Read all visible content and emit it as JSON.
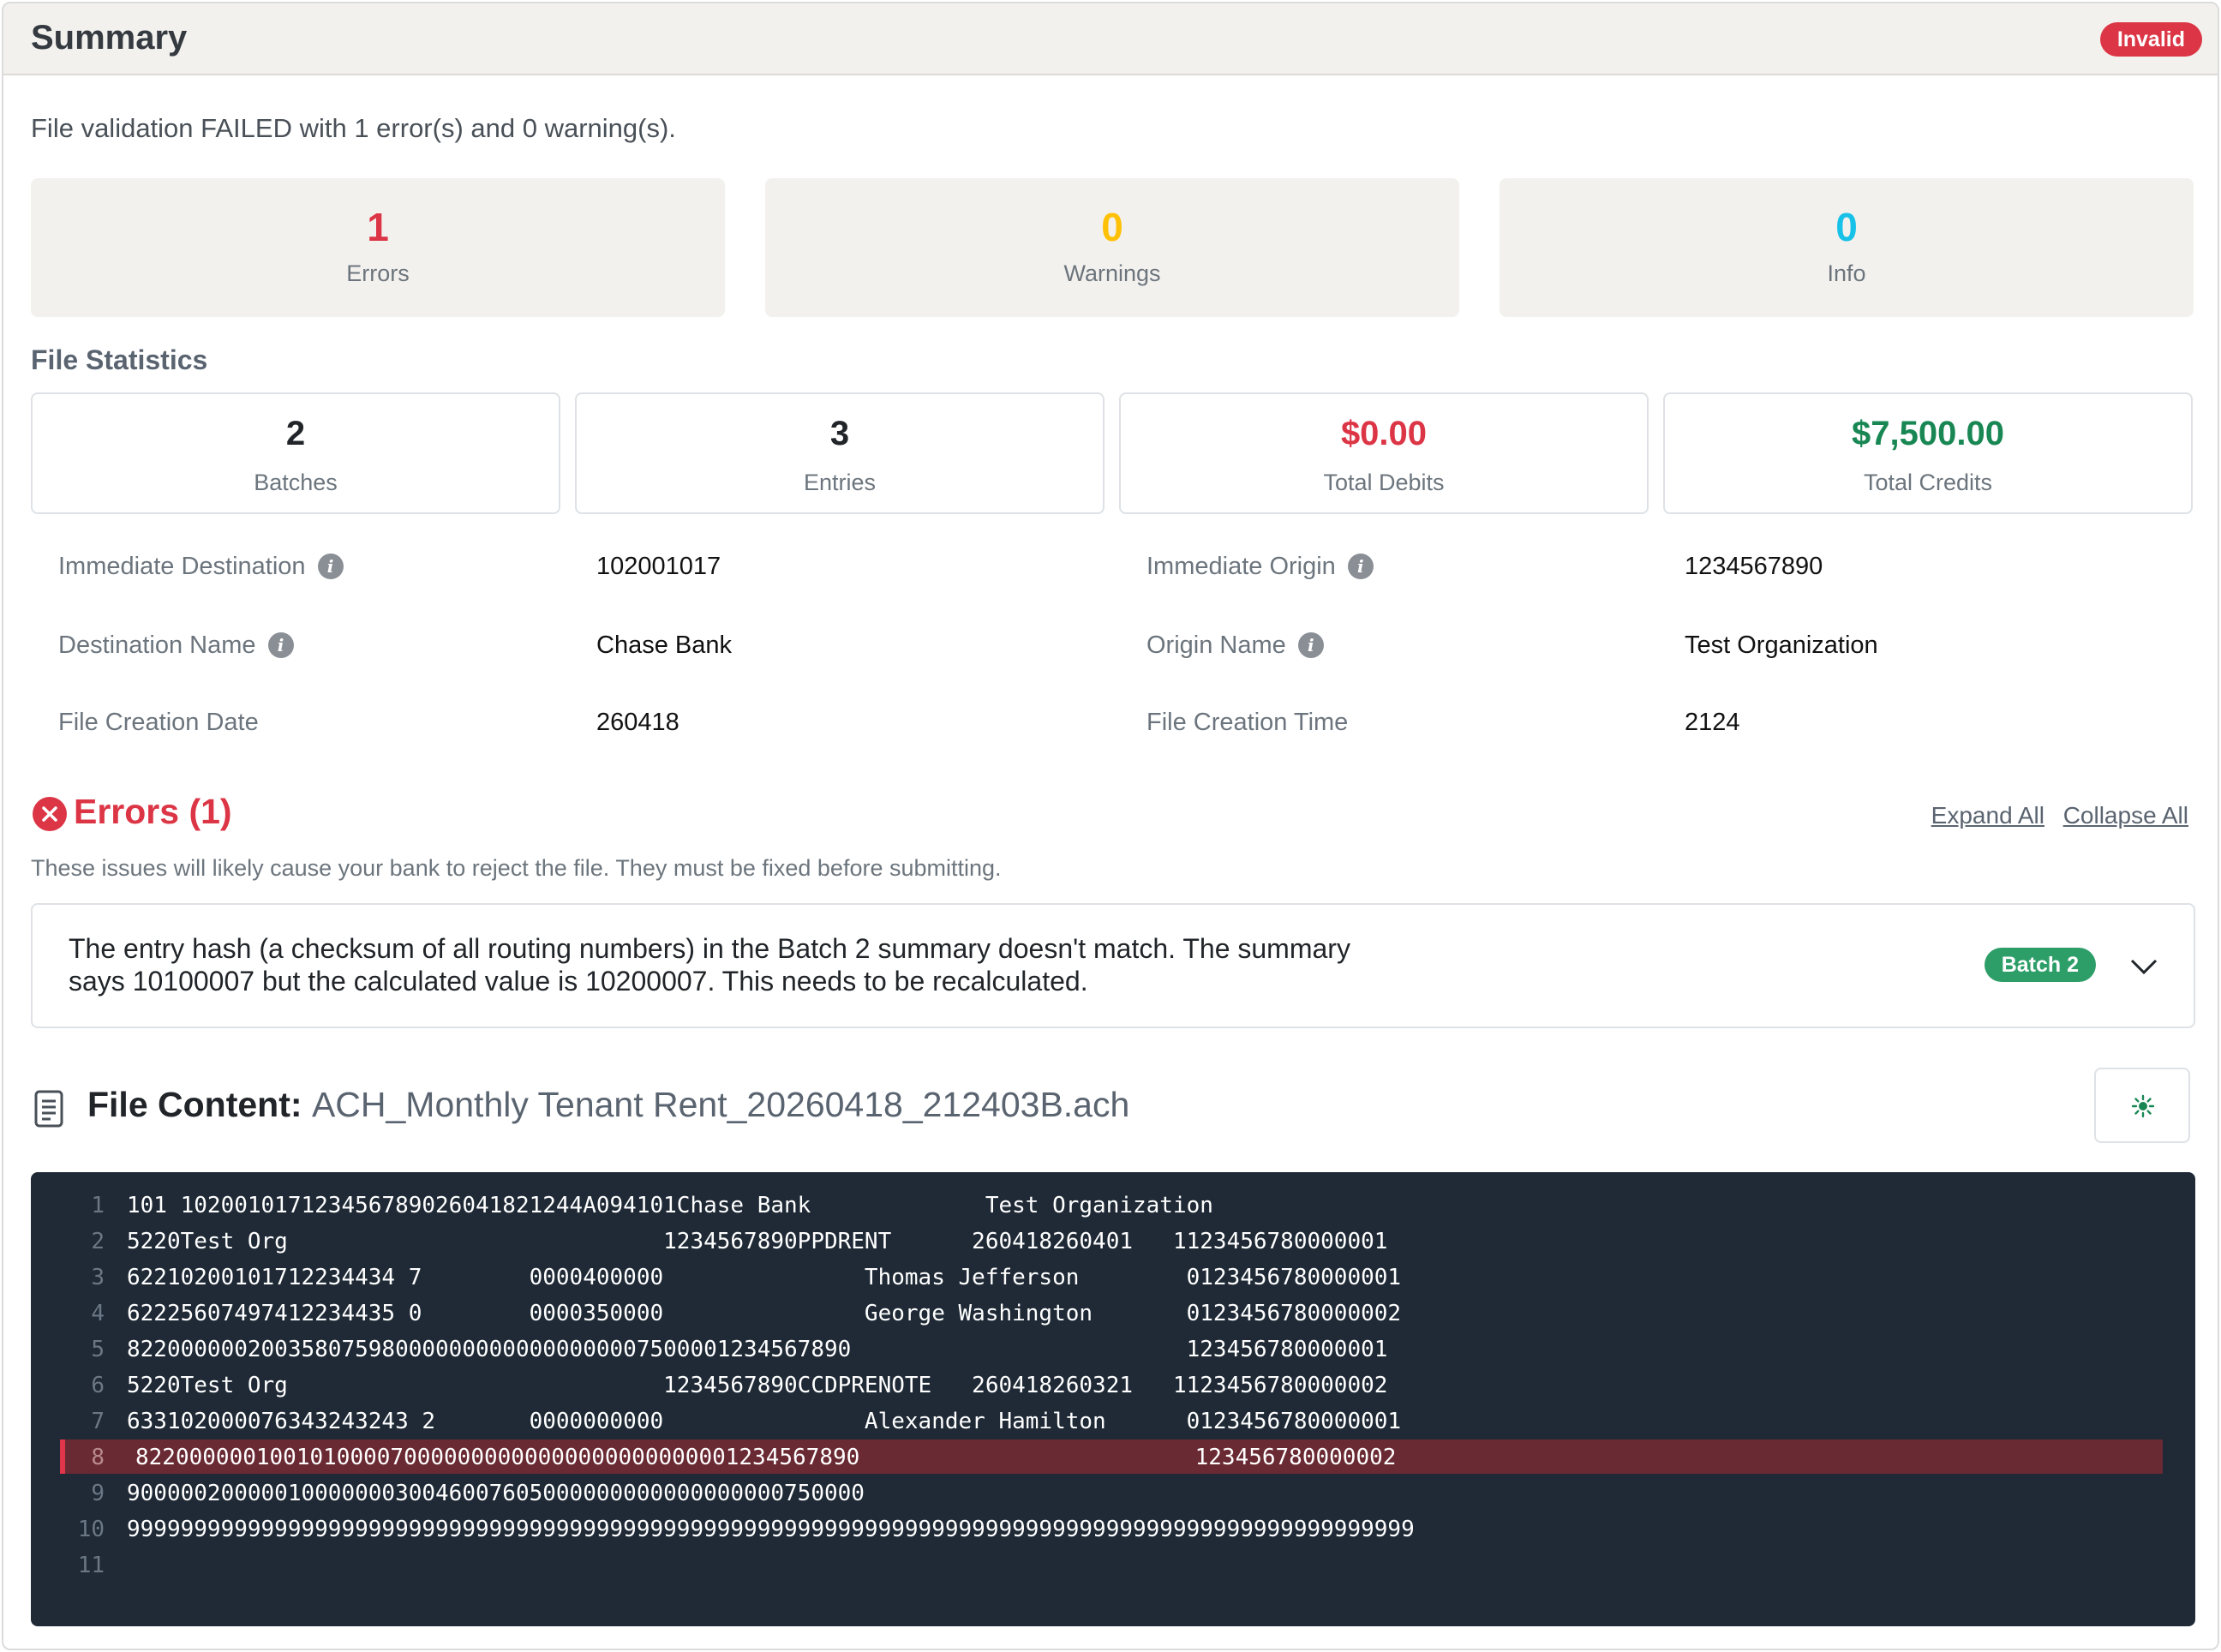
{
  "header": {
    "title": "Summary",
    "status_badge": "Invalid"
  },
  "summary_text": "File validation FAILED with 1 error(s) and 0 warning(s).",
  "counts": [
    {
      "value": "1",
      "label": "Errors",
      "color": "#dc3545"
    },
    {
      "value": "0",
      "label": "Warnings",
      "color": "#ffc107"
    },
    {
      "value": "0",
      "label": "Info",
      "color": "#17c1e8"
    }
  ],
  "stats_title": "File Statistics",
  "stats": [
    {
      "value": "2",
      "label": "Batches",
      "color": "#212529"
    },
    {
      "value": "3",
      "label": "Entries",
      "color": "#212529"
    },
    {
      "value": "$0.00",
      "label": "Total Debits",
      "color": "#dc3545"
    },
    {
      "value": "$7,500.00",
      "label": "Total Credits",
      "color": "#198754"
    }
  ],
  "details": [
    {
      "label": "Immediate Destination",
      "value": "102001017",
      "info_icon": true
    },
    {
      "label": "Immediate Origin",
      "value": "1234567890",
      "info_icon": true
    },
    {
      "label": "Destination Name",
      "value": "Chase Bank",
      "info_icon": true
    },
    {
      "label": "Origin Name",
      "value": "Test Organization",
      "info_icon": true
    },
    {
      "label": "File Creation Date",
      "value": "260418",
      "info_icon": false
    },
    {
      "label": "File Creation Time",
      "value": "2124",
      "info_icon": false
    }
  ],
  "errors_section": {
    "title": "Errors (1)",
    "expand_all": "Expand All",
    "collapse_all": "Collapse All",
    "description": "These issues will likely cause your bank to reject the file. They must be fixed before submitting.",
    "items": [
      {
        "message": "The entry hash (a checksum of all routing numbers) in the Batch 2 summary doesn't match. The summary says 10100007 but the calculated value is 10200007. This needs to be recalculated.",
        "badge": "Batch 2"
      }
    ]
  },
  "file_content": {
    "title": "File Content:",
    "filename": "ACH_Monthly Tenant Rent_20260418_212403B.ach",
    "highlighted_line": 8,
    "lines": [
      "101 102001017123456789026041821244A094101Chase Bank             Test Organization",
      "5220Test Org                            1234567890PPDRENT      260418260401   1123456780000001",
      "62210200101712234434 7        0000400000               Thomas Jefferson        0123456780000001",
      "62225607497412234435 0        0000350000               George Washington       0123456780000002",
      "822000000200358075980000000000000000007500001234567890                         123456780000001",
      "5220Test Org                            1234567890CCDPRENOTE   260418260321   1123456780000002",
      "633102000076343243243 2       0000000000               Alexander Hamilton      0123456780000001",
      "822000000100101000070000000000000000000000001234567890                         123456780000002",
      "9000002000001000000030046007605000000000000000000750000",
      "999999999999999999999999999999999999999999999999999999999999999999999999999999999999999999999999",
      ""
    ]
  },
  "icons": {
    "error": "x-circle-icon",
    "info": "info-icon",
    "document": "file-text-icon",
    "expand": "chevron-down-icon",
    "theme": "sun-icon"
  }
}
